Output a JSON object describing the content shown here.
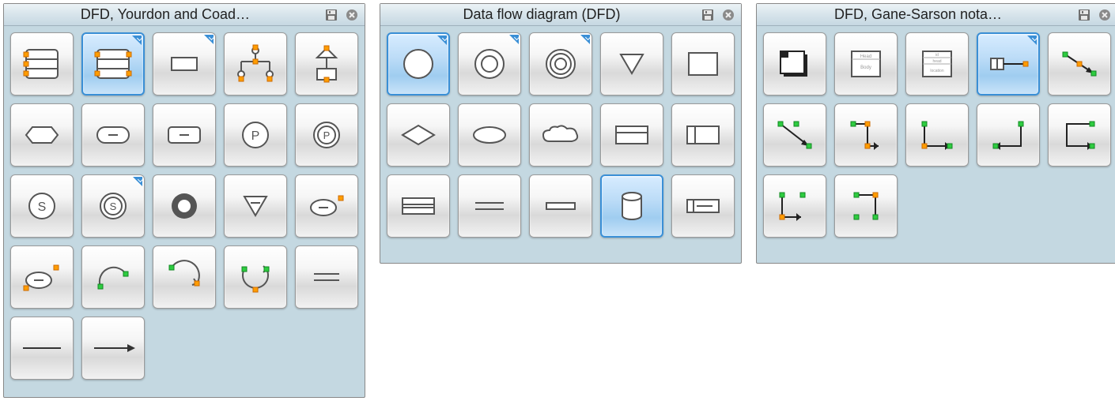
{
  "panels": [
    {
      "id": "yourdon",
      "title": "DFD, Yourdon and Coad…",
      "tools": [
        {
          "name": "data-store-icon",
          "svg": "datastore",
          "selected": false,
          "corner": false
        },
        {
          "name": "data-store-sel-icon",
          "svg": "datastore-sel",
          "selected": true,
          "corner": true
        },
        {
          "name": "rectangle-icon",
          "svg": "rect-small",
          "selected": false,
          "corner": true
        },
        {
          "name": "tree-icon",
          "svg": "tree",
          "selected": false,
          "corner": false
        },
        {
          "name": "class-icon",
          "svg": "class-sym",
          "selected": false,
          "corner": false
        },
        {
          "name": "hexagon-icon",
          "svg": "hexagon",
          "selected": false,
          "corner": false
        },
        {
          "name": "round-rect-icon",
          "svg": "roundrect",
          "selected": false,
          "corner": false
        },
        {
          "name": "round-rect2-icon",
          "svg": "roundrect-fill",
          "selected": false,
          "corner": false
        },
        {
          "name": "p-circle-icon",
          "svg": "pcircle",
          "selected": false,
          "corner": false
        },
        {
          "name": "p-circle-alt-icon",
          "svg": "pcircle-alt",
          "selected": false,
          "corner": false
        },
        {
          "name": "s-circle-icon",
          "svg": "scircle",
          "selected": false,
          "corner": false
        },
        {
          "name": "s-circle-sel-icon",
          "svg": "scircle-sel",
          "selected": false,
          "corner": true
        },
        {
          "name": "donut-icon",
          "svg": "donut",
          "selected": false,
          "corner": false
        },
        {
          "name": "triangle-down-icon",
          "svg": "tri-down",
          "selected": false,
          "corner": false
        },
        {
          "name": "ellipse-h-icon",
          "svg": "ellipse-handle",
          "selected": false,
          "corner": false
        },
        {
          "name": "ellipse-h2-icon",
          "svg": "ellipse-handle2",
          "selected": false,
          "corner": false
        },
        {
          "name": "arc-1-icon",
          "svg": "arc1",
          "selected": false,
          "corner": false
        },
        {
          "name": "arc-2-icon",
          "svg": "arc2",
          "selected": false,
          "corner": false
        },
        {
          "name": "arc-3-icon",
          "svg": "arc3",
          "selected": false,
          "corner": false
        },
        {
          "name": "equal-lines-icon",
          "svg": "eqlines",
          "selected": false,
          "corner": false
        },
        {
          "name": "line-icon",
          "svg": "line",
          "selected": false,
          "corner": false
        },
        {
          "name": "arrow-icon",
          "svg": "arrow",
          "selected": false,
          "corner": false
        }
      ]
    },
    {
      "id": "dfd",
      "title": "Data flow diagram (DFD)",
      "tools": [
        {
          "name": "circle-icon",
          "svg": "circle",
          "selected": true,
          "corner": true
        },
        {
          "name": "circle-2-icon",
          "svg": "circle2",
          "selected": false,
          "corner": true
        },
        {
          "name": "circle-3-icon",
          "svg": "circle3",
          "selected": false,
          "corner": true
        },
        {
          "name": "triangle-open-icon",
          "svg": "tri-open",
          "selected": false,
          "corner": false
        },
        {
          "name": "box-icon",
          "svg": "box",
          "selected": false,
          "corner": false
        },
        {
          "name": "diamond-icon",
          "svg": "diamond",
          "selected": false,
          "corner": false
        },
        {
          "name": "ellipse-icon",
          "svg": "ellipse",
          "selected": false,
          "corner": false
        },
        {
          "name": "cloud-icon",
          "svg": "cloud",
          "selected": false,
          "corner": false
        },
        {
          "name": "card-h-icon",
          "svg": "card-h",
          "selected": false,
          "corner": false
        },
        {
          "name": "card-v-icon",
          "svg": "card-v",
          "selected": false,
          "corner": false
        },
        {
          "name": "storage-icon",
          "svg": "storage",
          "selected": false,
          "corner": false
        },
        {
          "name": "double-line-icon",
          "svg": "dbl-line",
          "selected": false,
          "corner": false
        },
        {
          "name": "single-bar-icon",
          "svg": "single-bar",
          "selected": false,
          "corner": false
        },
        {
          "name": "database-sel-icon",
          "svg": "database",
          "selected": true,
          "corner": false
        },
        {
          "name": "card-left-icon",
          "svg": "card-left",
          "selected": false,
          "corner": false
        }
      ]
    },
    {
      "id": "gane",
      "title": "DFD, Gane-Sarson nota…",
      "tools": [
        {
          "name": "process-box-icon",
          "svg": "proc-box",
          "selected": false,
          "corner": false
        },
        {
          "name": "entity-box-icon",
          "svg": "entity-box",
          "selected": false,
          "corner": false
        },
        {
          "name": "labeled-box-icon",
          "svg": "label-box",
          "selected": false,
          "corner": false
        },
        {
          "name": "conn-h-icon",
          "svg": "conn-h",
          "selected": true,
          "corner": true
        },
        {
          "name": "conn-diag-icon",
          "svg": "conn-diag",
          "selected": false,
          "corner": false
        },
        {
          "name": "conn-down-icon",
          "svg": "conn-down",
          "selected": false,
          "corner": false
        },
        {
          "name": "conn-elbow-icon",
          "svg": "conn-elbow",
          "selected": false,
          "corner": false
        },
        {
          "name": "conn-elbow2-icon",
          "svg": "conn-elbow2",
          "selected": false,
          "corner": false
        },
        {
          "name": "conn-elbow3-icon",
          "svg": "conn-elbow3",
          "selected": false,
          "corner": false
        },
        {
          "name": "conn-elbow4-icon",
          "svg": "conn-elbow4",
          "selected": false,
          "corner": false
        },
        {
          "name": "conn-u1-icon",
          "svg": "conn-u1",
          "selected": false,
          "corner": false
        },
        {
          "name": "conn-u2-icon",
          "svg": "conn-u2",
          "selected": false,
          "corner": false
        }
      ]
    }
  ],
  "heights": {
    "yourdon": 500,
    "dfd": 330,
    "gane": 330
  }
}
